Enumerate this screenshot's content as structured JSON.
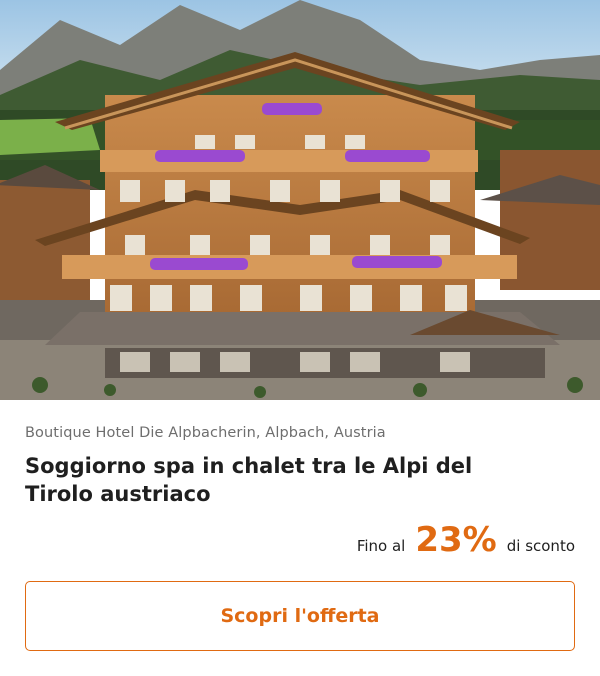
{
  "offer": {
    "location": "Boutique Hotel Die Alpbacherin, Alpbach, Austria",
    "title": "Soggiorno spa in chalet tra le Alpi del Tirolo austriaco",
    "discount_prefix": "Fino al",
    "discount_value": "23%",
    "discount_suffix": "di sconto",
    "cta_label": "Scopri l'offerta"
  },
  "colors": {
    "accent": "#e06a12",
    "text": "#1f1f1f",
    "muted": "#6e6e6e"
  }
}
